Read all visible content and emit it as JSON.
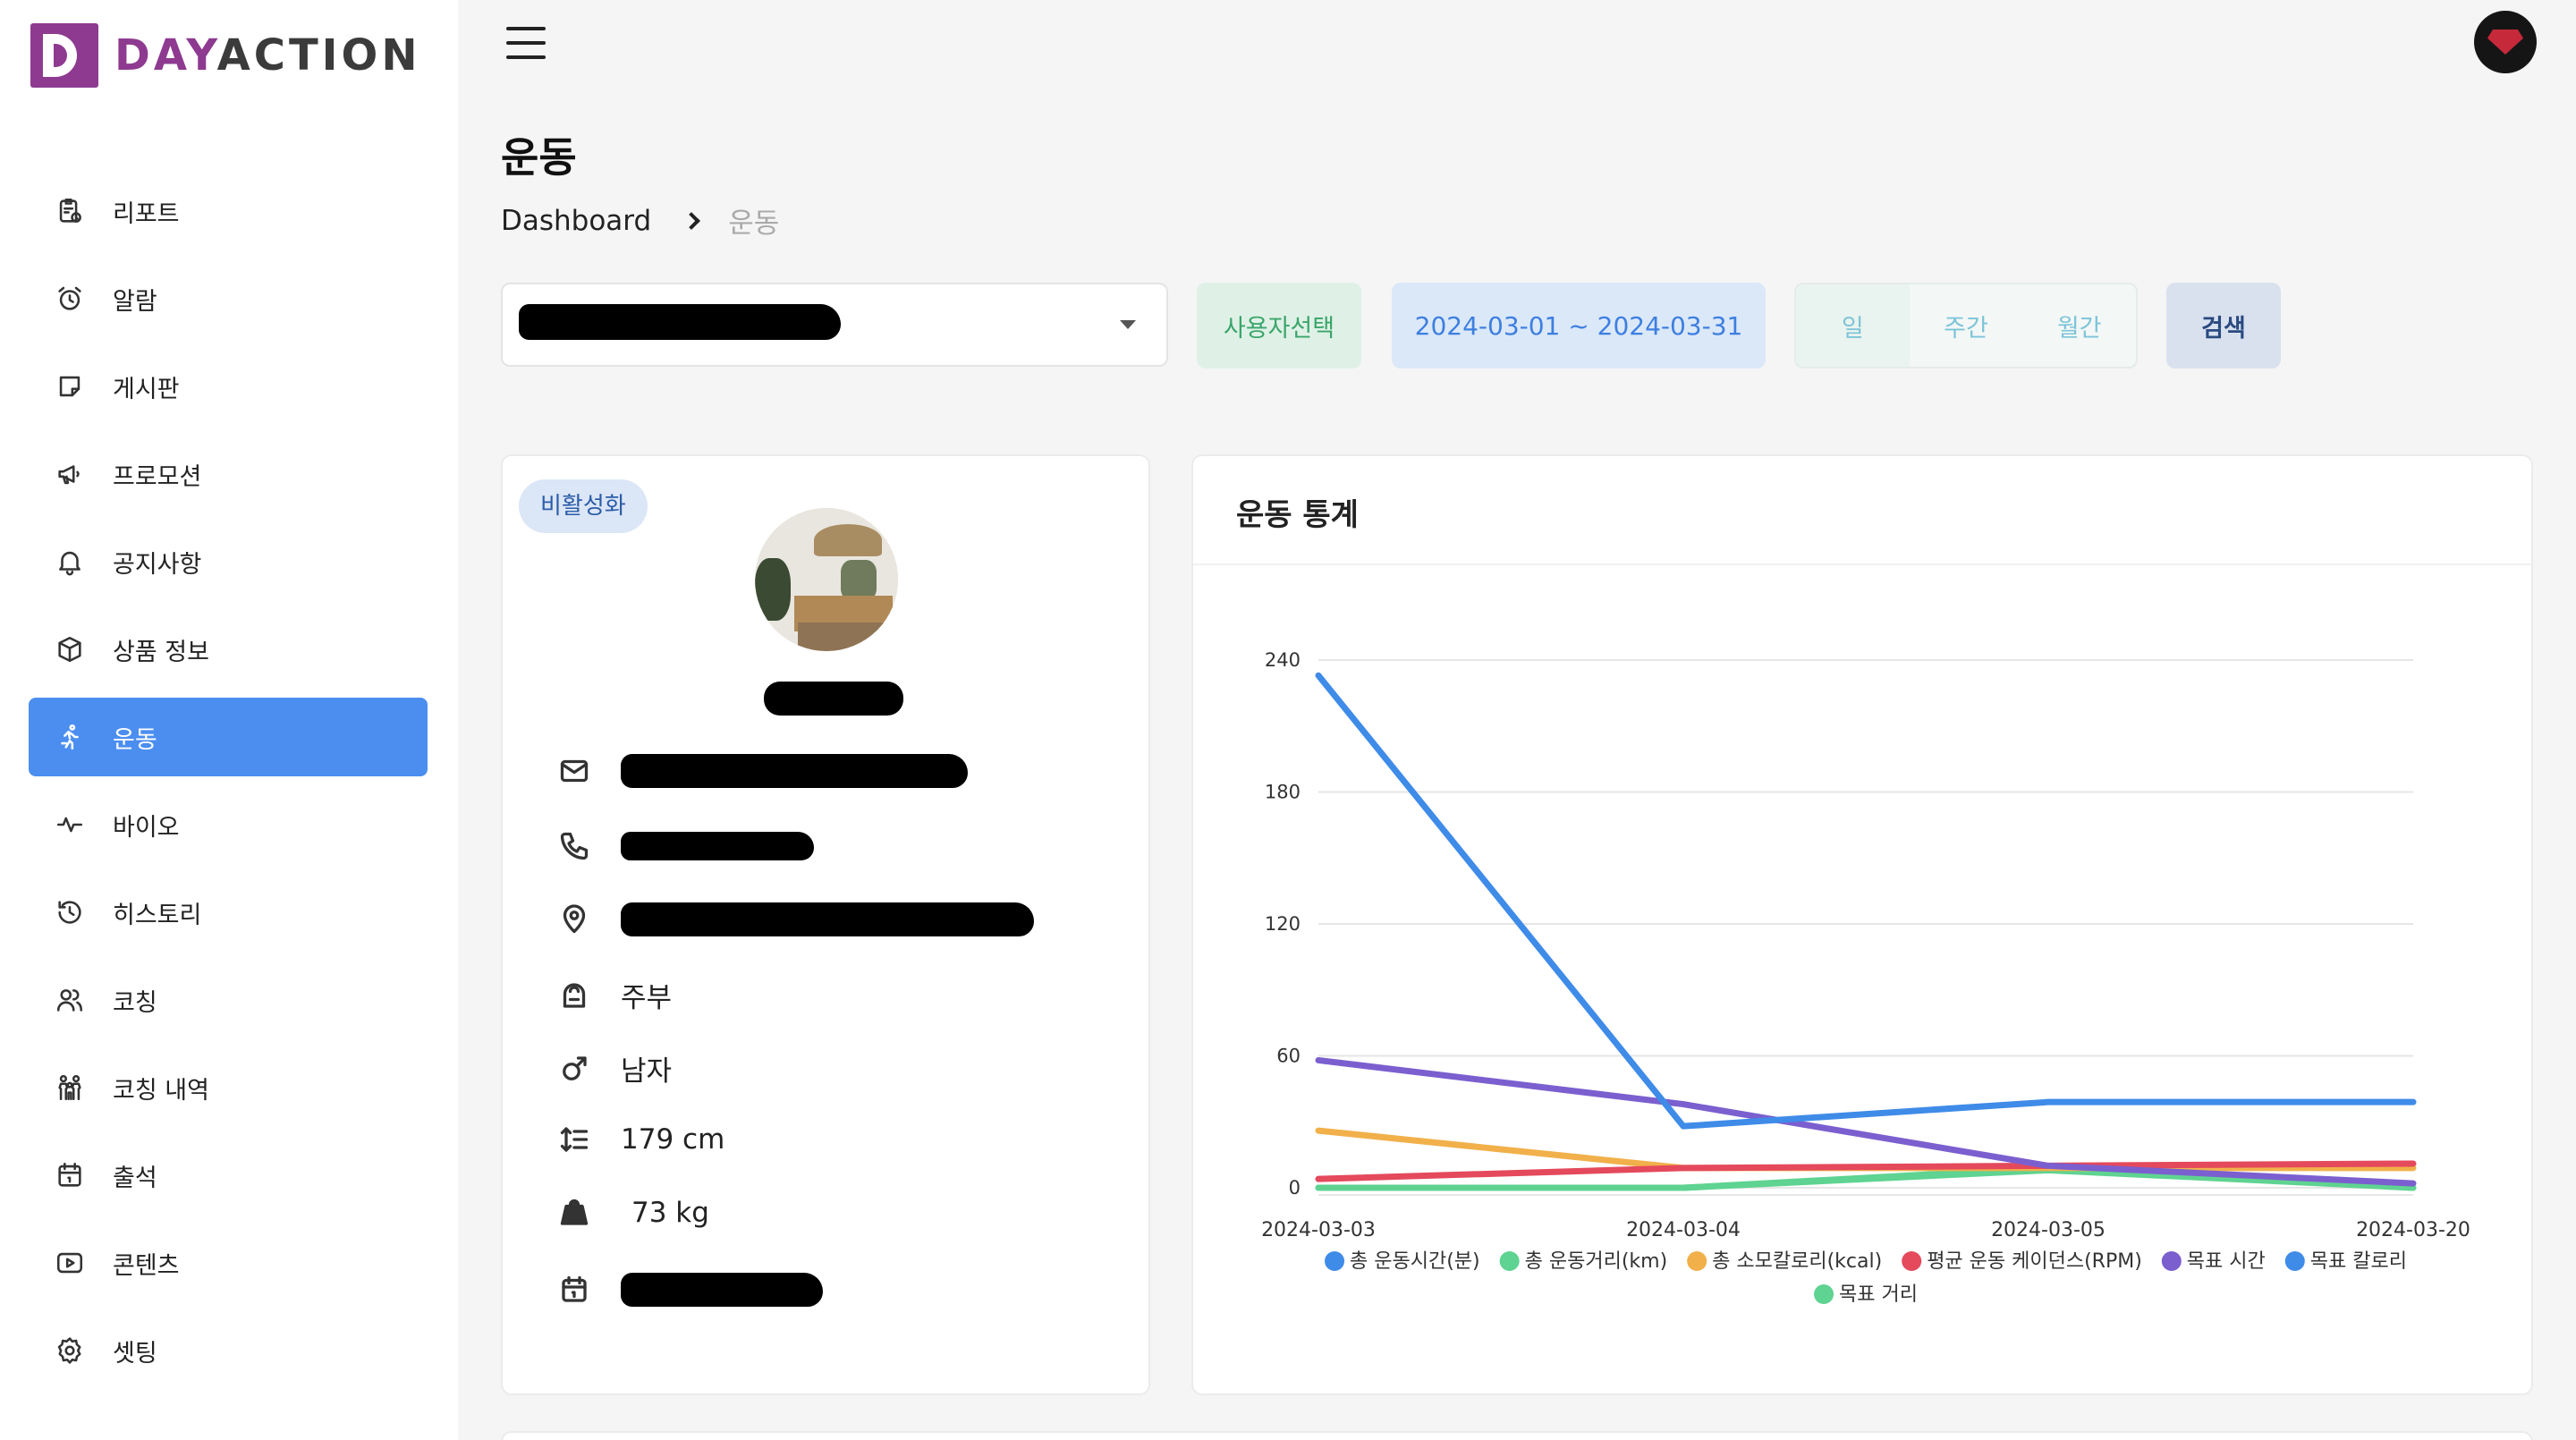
{
  "brand": {
    "day": "DAY",
    "action": "ACTION"
  },
  "sidebar": {
    "items": [
      {
        "label": "리포트",
        "icon": "report-icon"
      },
      {
        "label": "알람",
        "icon": "alarm-icon"
      },
      {
        "label": "게시판",
        "icon": "board-icon"
      },
      {
        "label": "프로모션",
        "icon": "megaphone-icon"
      },
      {
        "label": "공지사항",
        "icon": "bell-icon"
      },
      {
        "label": "상품 정보",
        "icon": "box-icon"
      },
      {
        "label": "운동",
        "icon": "run-icon",
        "active": true
      },
      {
        "label": "바이오",
        "icon": "pulse-icon"
      },
      {
        "label": "히스토리",
        "icon": "history-icon"
      },
      {
        "label": "코칭",
        "icon": "users-icon"
      },
      {
        "label": "코칭 내역",
        "icon": "group-icon"
      },
      {
        "label": "출석",
        "icon": "calendar-icon"
      },
      {
        "label": "콘텐츠",
        "icon": "play-icon"
      },
      {
        "label": "셋팅",
        "icon": "gear-icon"
      }
    ]
  },
  "header": {
    "title": "운동",
    "breadcrumb": {
      "home": "Dashboard",
      "current": "운동"
    }
  },
  "filters": {
    "user_select_button": "사용자선택",
    "date_range": "2024-03-01 ~ 2024-03-31",
    "periods": [
      "일",
      "주간",
      "월간"
    ],
    "search_button": "검색"
  },
  "profile": {
    "status_badge": "비활성화",
    "occupation": "주부",
    "gender": "남자",
    "height": "179 cm",
    "weight": "73 kg"
  },
  "chart": {
    "title": "운동 통계"
  },
  "colors": {
    "accent": "#4b8ef0",
    "brand": "#8e3a90"
  },
  "chart_data": {
    "type": "line",
    "x": [
      "2024-03-03",
      "2024-03-04",
      "2024-03-05",
      "2024-03-20"
    ],
    "y_ticks": [
      0,
      60,
      120,
      180,
      240
    ],
    "ylim": [
      0,
      240
    ],
    "grid": true,
    "legend_position": "bottom",
    "series": [
      {
        "name": "총 운동시간(분)",
        "color": "#3f8be8",
        "values": [
          233,
          28,
          39,
          39
        ]
      },
      {
        "name": "총 운동거리(km)",
        "color": "#5fd391",
        "values": [
          0,
          0,
          9,
          0
        ]
      },
      {
        "name": "총 소모칼로리(kcal)",
        "color": "#f1b04a",
        "values": [
          26,
          9,
          9,
          9
        ]
      },
      {
        "name": "평균 운동 케이던스(RPM)",
        "color": "#e4495c",
        "values": [
          4,
          9,
          10,
          11
        ]
      },
      {
        "name": "목표 시간",
        "color": "#7b5fcf",
        "values": [
          58,
          38,
          10,
          2
        ]
      },
      {
        "name": "목표 칼로리",
        "color": "#3f8be8",
        "values": [
          0,
          0,
          0,
          0
        ]
      },
      {
        "name": "목표 거리",
        "color": "#5fd391",
        "values": [
          0,
          0,
          8,
          0
        ]
      }
    ]
  }
}
